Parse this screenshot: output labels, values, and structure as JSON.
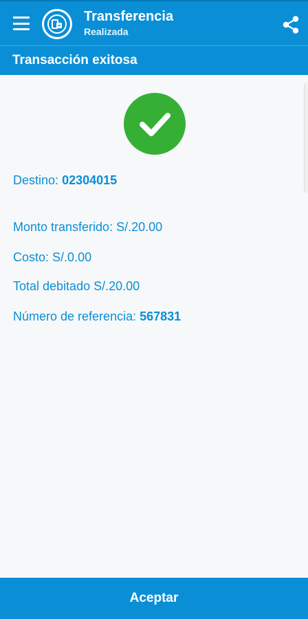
{
  "appbar": {
    "title": "Transferencia",
    "subtitle": "Realizada",
    "icons": [
      "menu-icon",
      "bank-logo",
      "share-icon"
    ]
  },
  "section": {
    "title": "Transacción exitosa"
  },
  "status": {
    "icon": "check-circle-icon",
    "color": "#35b035"
  },
  "details": {
    "destino_label": "Destino:",
    "destino_value": "02304015",
    "monto_label": "Monto transferido:",
    "monto_value": "S/.20.00",
    "costo_label": "Costo:",
    "costo_value": "S/.0.00",
    "total_label": "Total debitado",
    "total_value": "S/.20.00",
    "referencia_label": "Número de referencia:",
    "referencia_value": "567831"
  },
  "footer": {
    "accept_label": "Aceptar"
  },
  "colors": {
    "primary": "#0a8fd6",
    "success": "#35b035",
    "background": "#f7f8f9"
  }
}
